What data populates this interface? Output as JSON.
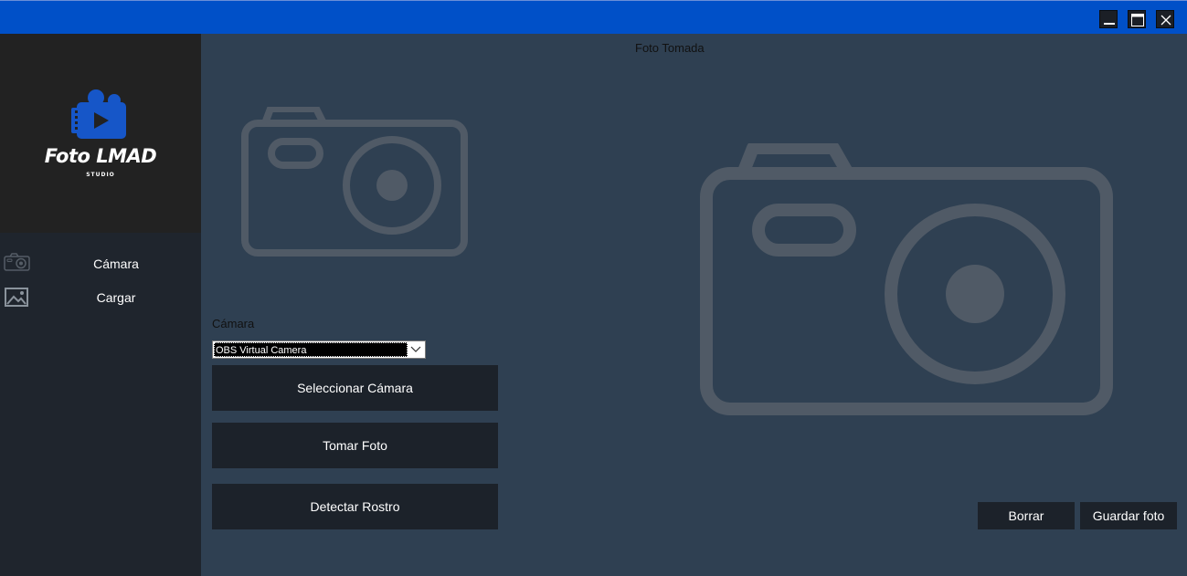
{
  "window": {
    "minimize_icon": "minimize-icon",
    "maximize_icon": "maximize-icon",
    "close_icon": "close-icon",
    "titlebar_color": "#0050c8"
  },
  "sidebar": {
    "logo": {
      "title": "Foto LMAD",
      "subtitle": "STUDIO",
      "icon": "video-camera-icon",
      "accent": "#1656c8"
    },
    "items": [
      {
        "label": "Cámara",
        "icon": "camera-icon"
      },
      {
        "label": "Cargar",
        "icon": "image-icon"
      }
    ]
  },
  "main": {
    "photo_title": "Foto Tomada",
    "camera": {
      "label": "Cámara",
      "selected": "OBS Virtual Camera"
    },
    "buttons": {
      "select_camera": "Seleccionar Cámara",
      "take_photo": "Tomar Foto",
      "detect_face": "Detectar Rostro",
      "clear": "Borrar",
      "save": "Guardar foto"
    },
    "placeholder_icon": "camera-placeholder-icon",
    "placeholder_color": "#505a66"
  }
}
